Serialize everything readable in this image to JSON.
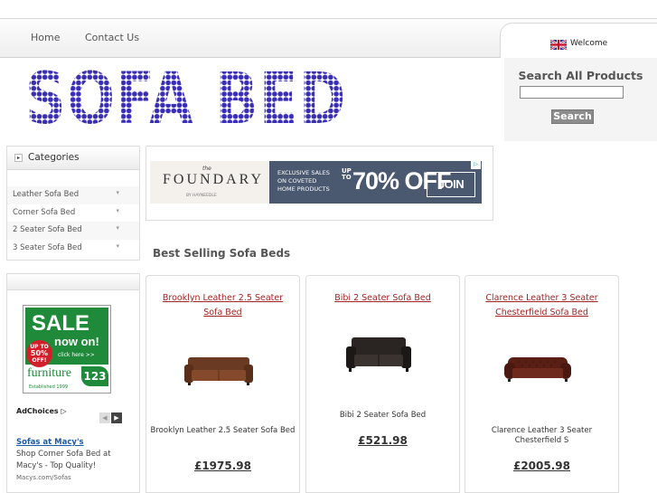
{
  "nav": {
    "home": "Home",
    "contact": "Contact Us",
    "welcome": "Welcome"
  },
  "header": {
    "logo_text": "SOFA BED",
    "search_title": "Search All Products",
    "search_value": "",
    "search_button": "Search"
  },
  "categories": {
    "title": "Categories",
    "items": [
      {
        "label": "Leather Sofa Bed"
      },
      {
        "label": "Corner Sofa Bed"
      },
      {
        "label": "2 Seater Sofa Bed"
      },
      {
        "label": "3 Seater Sofa Bed"
      }
    ]
  },
  "side_ad": {
    "sale": "SALE",
    "now_on": "now on!",
    "up_to": "UP TO",
    "percent": "50%",
    "off": "OFF!",
    "click_here": "click here >>",
    "brand": "furniture",
    "brand_number": "123",
    "established": "Established 1999",
    "adchoices": "AdChoices",
    "title": "Sofas at Macy's",
    "description": "Shop Corner Sofa Bed at Macy's - Top Quality!",
    "url": "Macys.com/Sofas"
  },
  "banner": {
    "the": "the",
    "brand": "FOUNDARY",
    "by": "BY HAYNEEDLE",
    "exclusive": "EXCLUSIVE SALES",
    "on_coveted": "ON COVETED",
    "home_products": "HOME PRODUCTS",
    "up_to": "UP TO",
    "offer": "70% OFF",
    "join": "JOIN NOW"
  },
  "section_title": "Best Selling Sofa Beds",
  "products": [
    {
      "name": "Brooklyn Leather 2.5 Seater Sofa Bed",
      "caption": "Brooklyn Leather 2.5 Seater Sofa Bed",
      "price": "£1975.98"
    },
    {
      "name": "Bibi 2 Seater Sofa Bed",
      "caption": "Bibi 2 Seater Sofa Bed",
      "price": "£521.98"
    },
    {
      "name": "Clarence Leather 3 Seater Chesterfield Sofa Bed",
      "caption": "Clarence Leather 3 Seater Chesterfield S",
      "price": "£2005.98"
    }
  ],
  "colors": {
    "logo": "#3a2fb4",
    "link_red": "#a42323",
    "ad_green": "#1f8a3a"
  }
}
